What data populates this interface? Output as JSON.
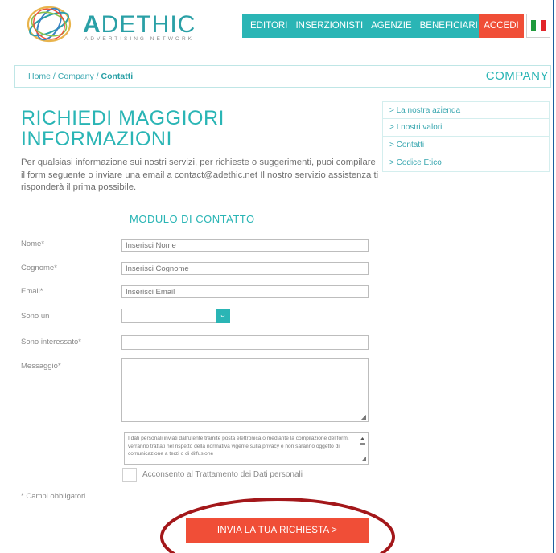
{
  "header": {
    "logo_text": "DETHIC",
    "logo_letter": "A",
    "logo_subtitle": "ADVERTISING NETWORK",
    "nav": [
      "EDITORI",
      "INSERZIONISTI",
      "AGENZIE",
      "BENEFICIARI"
    ],
    "login_label": "ACCEDI",
    "flag_icon": "italian-flag-icon"
  },
  "breadcrumb": {
    "home": "Home",
    "sep1": " / ",
    "company": "Company",
    "sep2": " / ",
    "current": "Contatti",
    "section": "COMPANY"
  },
  "title": [
    "RICHIEDI MAGGIORI",
    "INFORMAZIONI"
  ],
  "intro": "Per qualsiasi informazione sui nostri servizi, per richieste o suggerimenti, puoi compilare il form seguente o inviare una email a contact@adethic.net Il nostro servizio assistenza ti risponderà il prima possibile.",
  "side_menu": [
    "> La nostra azienda",
    "> I nostri valori",
    "> Contatti",
    "> Codice Etico"
  ],
  "form": {
    "heading": "MODULO DI CONTATTO",
    "nome_label": "Nome*",
    "nome_placeholder": "Inserisci Nome",
    "cognome_label": "Cognome*",
    "cognome_placeholder": "Inserisci Cognome",
    "email_label": "Email*",
    "email_placeholder": "Inserisci Email",
    "sono_label": "Sono un",
    "sono_value": "",
    "interessato_label": "Sono interessato*",
    "messaggio_label": "Messaggio*",
    "privacy_text": "I dati personali inviati dall'utente tramite posta elettronica o mediante la compilazione del form, verranno trattati nel rispetto della normativa vigente sulla privacy e non saranno oggetto di comunicazione a terzi o di diffusione",
    "consent_label": "Acconsento al Trattamento dei Dati personali",
    "required_note": "* Campi obbligatori",
    "submit_label": "INVIA LA TUA RICHIESTA >"
  },
  "colors": {
    "accent": "#2ab5b5",
    "cta": "#f04e37",
    "annotation_ring": "#a3171a"
  }
}
